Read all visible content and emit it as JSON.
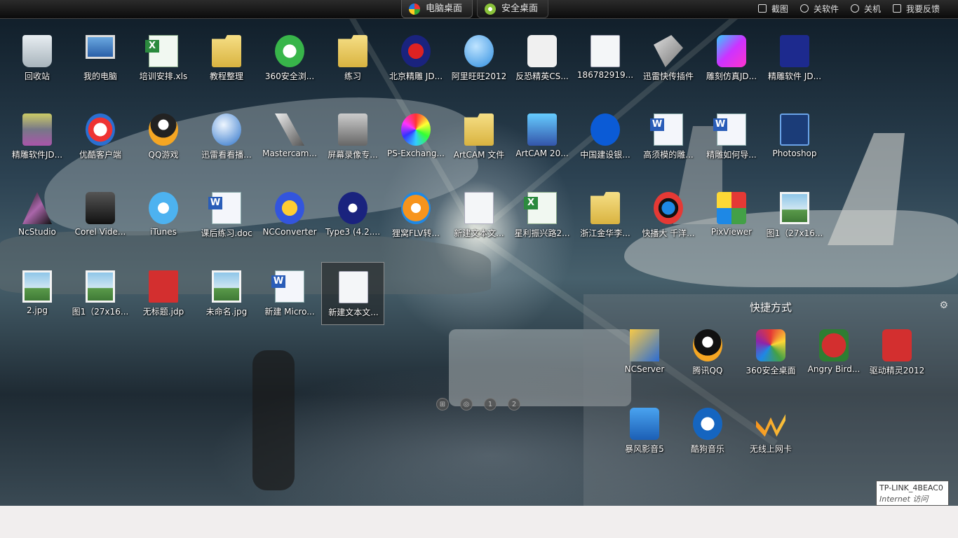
{
  "top_bar": {
    "tabs": [
      {
        "label": "电脑桌面"
      },
      {
        "label": "安全桌面"
      }
    ],
    "buttons": [
      {
        "label": "截图",
        "icon": "screenshot-icon"
      },
      {
        "label": "关软件",
        "icon": "minus-circle-icon"
      },
      {
        "label": "关机",
        "icon": "power-icon"
      },
      {
        "label": "我要反馈",
        "icon": "chat-icon"
      }
    ]
  },
  "desktop_icons": [
    {
      "label": "回收站",
      "kind": "recycle-bin-icon"
    },
    {
      "label": "我的电脑",
      "kind": "computer-icon"
    },
    {
      "label": "培训安排.xls",
      "kind": "excel-file-icon"
    },
    {
      "label": "教程整理",
      "kind": "folder-icon"
    },
    {
      "label": "360安全浏...",
      "kind": "browser-360-icon"
    },
    {
      "label": "练习",
      "kind": "folder-icon"
    },
    {
      "label": "北京精雕 JD...",
      "kind": "jd-app-icon"
    },
    {
      "label": "阿里旺旺2012",
      "kind": "wangwang-icon"
    },
    {
      "label": "反恐精英CS...",
      "kind": "counter-strike-icon"
    },
    {
      "label": "186782919...",
      "kind": "text-file-icon"
    },
    {
      "label": "迅雷快传插件",
      "kind": "shortcut-icon"
    },
    {
      "label": "雕刻仿真JD...",
      "kind": "jd-sim-icon"
    },
    {
      "label": "精雕软件 JD...",
      "kind": "jd-software-icon"
    },
    {
      "label": "精雕软件JD...",
      "kind": "engraving-icon"
    },
    {
      "label": "优酷客户端",
      "kind": "youku-icon"
    },
    {
      "label": "QQ游戏",
      "kind": "qq-game-icon"
    },
    {
      "label": "迅雷看看播...",
      "kind": "xunlei-player-icon"
    },
    {
      "label": "Mastercam...",
      "kind": "mastercam-icon"
    },
    {
      "label": "屏幕录像专...",
      "kind": "screen-recorder-icon"
    },
    {
      "label": "PS-Exchang...",
      "kind": "ps-exchange-icon"
    },
    {
      "label": "ArtCAM 文件",
      "kind": "folder-icon"
    },
    {
      "label": "ArtCAM 20...",
      "kind": "artcam-icon"
    },
    {
      "label": "中国建设银...",
      "kind": "ccb-icon"
    },
    {
      "label": "高须模的雕...",
      "kind": "word-file-icon"
    },
    {
      "label": "精雕如何导...",
      "kind": "word-file-icon"
    },
    {
      "label": "Photoshop",
      "kind": "photoshop-icon"
    },
    {
      "label": "NcStudio",
      "kind": "ncstudio-icon"
    },
    {
      "label": "Corel Vide...",
      "kind": "corel-video-icon"
    },
    {
      "label": "iTunes",
      "kind": "itunes-icon"
    },
    {
      "label": "课后练习.doc",
      "kind": "word-file-icon"
    },
    {
      "label": "NCConverter",
      "kind": "ncconverter-icon"
    },
    {
      "label": "Type3 (4.2....",
      "kind": "type3-icon"
    },
    {
      "label": "狸窝FLV转...",
      "kind": "flv-converter-icon"
    },
    {
      "label": "新建文本文...",
      "kind": "text-file-icon"
    },
    {
      "label": "星利振兴路2...",
      "kind": "excel-file-icon"
    },
    {
      "label": "浙江金华李...",
      "kind": "folder-icon"
    },
    {
      "label": "快播大 千洋...",
      "kind": "qvod-icon"
    },
    {
      "label": "PixViewer",
      "kind": "pixviewer-icon"
    },
    {
      "label": "图1（27x16...",
      "kind": "image-file-icon"
    },
    {
      "label": "2.jpg",
      "kind": "image-file-icon"
    },
    {
      "label": "图1（27x16...",
      "kind": "image-file-icon"
    },
    {
      "label": "无标题.jdp",
      "kind": "jdp-file-icon"
    },
    {
      "label": "未命名.jpg",
      "kind": "image-file-icon"
    },
    {
      "label": "新建 Micro...",
      "kind": "word-file-icon"
    },
    {
      "label": "新建文本文...",
      "kind": "text-file-icon"
    }
  ],
  "shortcut_panel": {
    "title": "快捷方式",
    "items": [
      {
        "label": "NCServer",
        "kind": "ncserver-icon"
      },
      {
        "label": "腾讯QQ",
        "kind": "qq-icon"
      },
      {
        "label": "360安全桌面",
        "kind": "desktop-360-icon"
      },
      {
        "label": "Angry Bird...",
        "kind": "angry-birds-icon"
      },
      {
        "label": "驱动精灵2012",
        "kind": "driver-genius-icon"
      },
      {
        "label": "暴风影音5",
        "kind": "baofeng-icon"
      },
      {
        "label": "酷狗音乐",
        "kind": "kugou-icon"
      },
      {
        "label": "无线上网卡",
        "kind": "wireless-card-icon"
      }
    ]
  },
  "pager": [
    "1",
    "2"
  ],
  "tooltip": {
    "line1": "TP-LINK_4BEAC0",
    "line2": "Internet 访问"
  }
}
